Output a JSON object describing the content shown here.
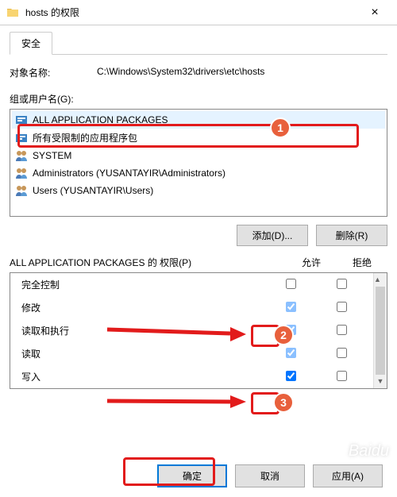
{
  "titlebar": {
    "title": "hosts 的权限"
  },
  "tabs": {
    "security": "安全"
  },
  "object": {
    "label": "对象名称:",
    "path": "C:\\Windows\\System32\\drivers\\etc\\hosts"
  },
  "groups": {
    "label": "组或用户名(G):",
    "items": [
      {
        "name": "ALL APPLICATION PACKAGES"
      },
      {
        "name": "所有受限制的应用程序包"
      },
      {
        "name": "SYSTEM"
      },
      {
        "name": "Administrators (YUSANTAYIR\\Administrators)"
      },
      {
        "name": "Users (YUSANTAYIR\\Users)"
      }
    ]
  },
  "buttons": {
    "add": "添加(D)...",
    "remove": "删除(R)",
    "ok": "确定",
    "cancel": "取消",
    "apply": "应用(A)"
  },
  "perms": {
    "title": "ALL APPLICATION PACKAGES 的 权限(P)",
    "colAllow": "允许",
    "colDeny": "拒绝",
    "rows": [
      {
        "label": "完全控制",
        "allow": false,
        "allowDim": false,
        "deny": false
      },
      {
        "label": "修改",
        "allow": true,
        "allowDim": true,
        "deny": false
      },
      {
        "label": "读取和执行",
        "allow": true,
        "allowDim": true,
        "deny": false
      },
      {
        "label": "读取",
        "allow": true,
        "allowDim": true,
        "deny": false
      },
      {
        "label": "写入",
        "allow": true,
        "allowDim": false,
        "deny": false
      }
    ]
  },
  "annotations": {
    "b1": "1",
    "b2": "2",
    "b3": "3"
  }
}
